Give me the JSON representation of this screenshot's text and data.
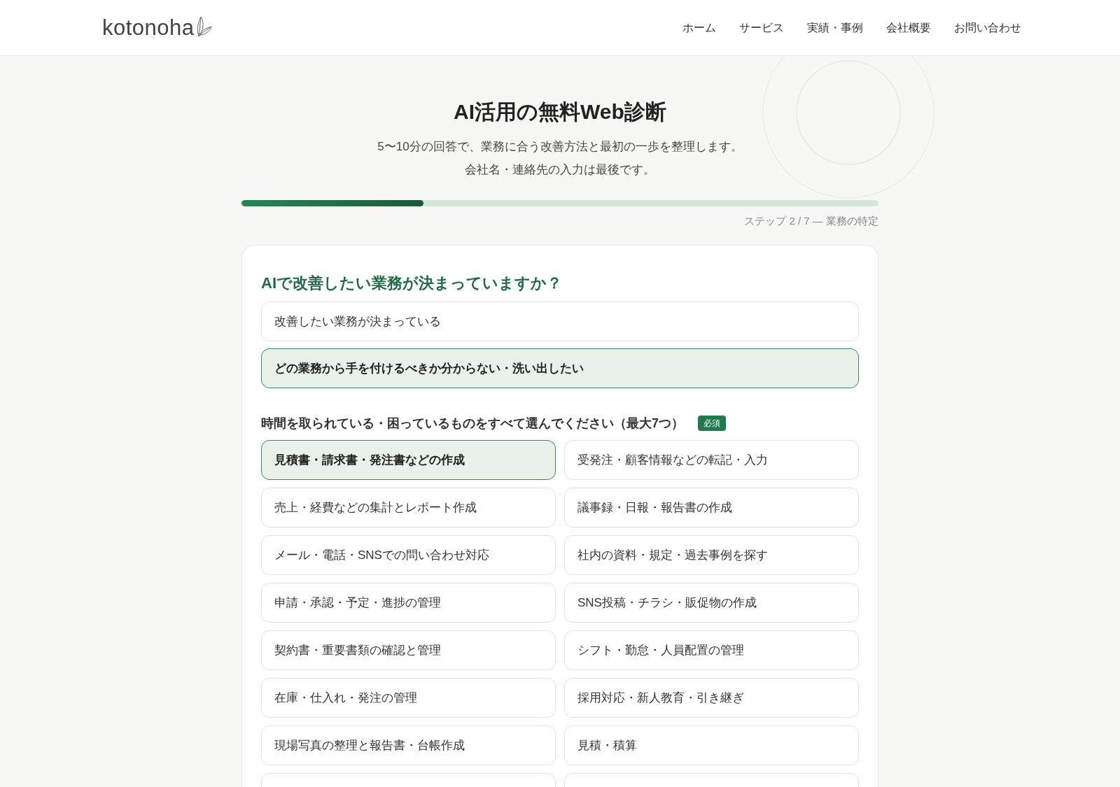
{
  "header": {
    "logo": "kotonoha",
    "nav": [
      "ホーム",
      "サービス",
      "実績・事例",
      "会社概要",
      "お問い合わせ"
    ]
  },
  "hero": {
    "title": "AI活用の無料Web診断",
    "subtitle_lines": [
      "5〜10分の回答で、業務に合う改善方法と最初の一歩を整理します。",
      "会社名・連絡先の入力は最後です。"
    ]
  },
  "progress": {
    "level": 0.2857,
    "label": "ステップ 2 / 7 — 業務の特定"
  },
  "question": {
    "title": "AIで改善したい業務が決まっていますか？",
    "options": [
      {
        "label": "改善したい業務が決まっている",
        "selected": false
      },
      {
        "label": "どの業務から手を付けるべきか分からない・洗い出したい",
        "selected": true
      }
    ]
  },
  "tasks": {
    "title": "時間を取られている・困っているものをすべて選んでください（最大7つ）",
    "badge": "必須",
    "options": [
      {
        "label": "見積書・請求書・発注書などの作成",
        "selected": true
      },
      {
        "label": "受発注・顧客情報などの転記・入力",
        "selected": false
      },
      {
        "label": "売上・経費などの集計とレポート作成",
        "selected": false
      },
      {
        "label": "議事録・日報・報告書の作成",
        "selected": false
      },
      {
        "label": "メール・電話・SNSでの問い合わせ対応",
        "selected": false
      },
      {
        "label": "社内の資料・規定・過去事例を探す",
        "selected": false
      },
      {
        "label": "申請・承認・予定・進捗の管理",
        "selected": false
      },
      {
        "label": "SNS投稿・チラシ・販促物の作成",
        "selected": false
      },
      {
        "label": "契約書・重要書類の確認と管理",
        "selected": false
      },
      {
        "label": "シフト・勤怠・人員配置の管理",
        "selected": false
      },
      {
        "label": "在庫・仕入れ・発注の管理",
        "selected": false
      },
      {
        "label": "採用対応・新人教育・引き継ぎ",
        "selected": false
      },
      {
        "label": "現場写真の整理と報告書・台帳作成",
        "selected": false
      },
      {
        "label": "見積・積算",
        "selected": false
      },
      {
        "selected": false
      },
      {
        "selected": false
      }
    ]
  }
}
